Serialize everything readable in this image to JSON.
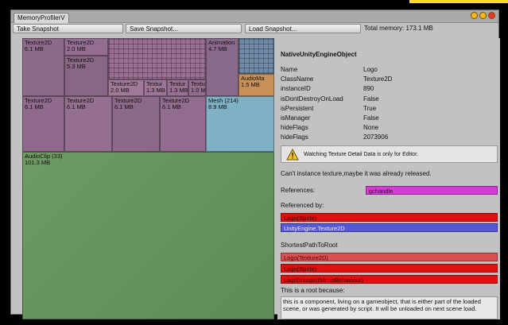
{
  "window": {
    "tab_title": "MemoryProfilerV"
  },
  "toolbar": {
    "take_snapshot": "Take Snapshot",
    "save_snapshot": "Save Snapshot...",
    "load_snapshot": "Load Snapshot...",
    "total_memory": "Total memory: 173.1 MB"
  },
  "treemap": {
    "cells": [
      {
        "label": "Texture2D",
        "size": "6.1 MB"
      },
      {
        "label": "Texture2D",
        "size": "2.0 MB"
      },
      {
        "label": "Texture2D",
        "size": "5.3 MB"
      },
      {
        "label": "Texture2D",
        "size": "2.0 MB"
      },
      {
        "label": "Textur",
        "size": "1.3 MB"
      },
      {
        "label": "Textur",
        "size": "1.3 MB"
      },
      {
        "label": "Textu",
        "size": "1.0 M"
      },
      {
        "label": "Animation",
        "size": "4.7 MB"
      },
      {
        "label": "AudioMa",
        "size": "1.5 MB"
      },
      {
        "label": "Texture2D",
        "size": "6.1 MB"
      },
      {
        "label": "Texture2D",
        "size": "6.1 MB"
      },
      {
        "label": "Texture2D",
        "size": "6.1 MB"
      },
      {
        "label": "Texture2D",
        "size": "6.1 MB"
      },
      {
        "label": "Mesh (214)",
        "size": "8.9 MB"
      },
      {
        "label": "AudioClip (33)",
        "size": "101.3 MB"
      }
    ]
  },
  "details": {
    "title": "NativeUnityEngineObject",
    "props": [
      {
        "key": "Name",
        "value": "Logo"
      },
      {
        "key": "ClassName",
        "value": "Texture2D"
      },
      {
        "key": "instanceID",
        "value": "890"
      },
      {
        "key": "isDontDestroyOnLoad",
        "value": "False"
      },
      {
        "key": "isPersistent",
        "value": "True"
      },
      {
        "key": "isManager",
        "value": "False"
      },
      {
        "key": "hideFlags",
        "value": "None"
      },
      {
        "key": "hideFlags",
        "value": "2073906"
      }
    ],
    "warning": "Watching Texture Detail Data is only for Editor.",
    "cant_instance": "Can't instance texture,maybe it was already released.",
    "references_label": "References:",
    "references_item": "gchandle",
    "referenced_by_label": "Referenced by:",
    "referenced_by": [
      "Logo(Sprite)",
      "UnityEngine.Texture2D"
    ],
    "shortest_path_label": "ShortestPathToRoot",
    "shortest_path": [
      "Logo(Texture2D)",
      "Logo(Sprite)",
      "Logo(Image)(MonoBehaviour)"
    ],
    "root_because_label": "This is a root because:",
    "root_because_text": "this is a component, living on a gameobject, that is either part of the loaded scene, or was generated by script. It will be unloaded on next scene load."
  },
  "colors": {
    "accent": "#ffd92a",
    "ref_red": "#e01010",
    "ref_blue": "#5656d6",
    "ref_magenta": "#d63ad6"
  }
}
